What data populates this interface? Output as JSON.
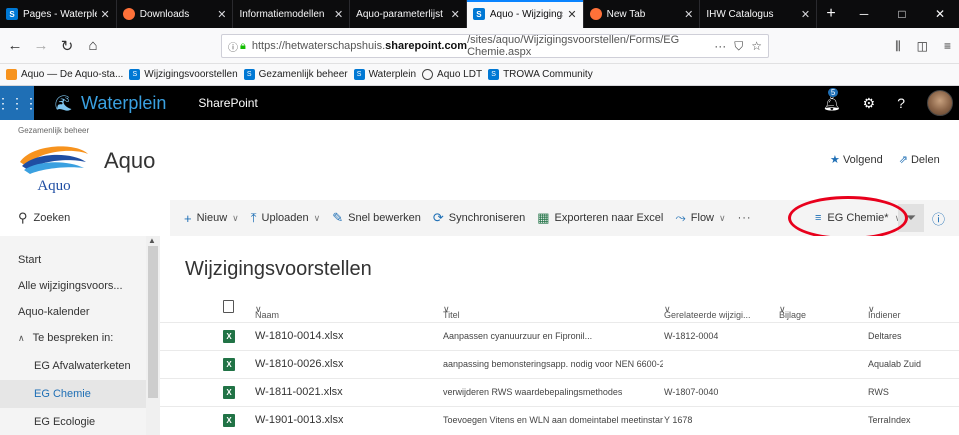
{
  "browser": {
    "tabs": [
      {
        "label": "Pages - Waterplein",
        "icon": "sharepoint-icon",
        "active": false
      },
      {
        "label": "Downloads",
        "icon": "firefox-icon",
        "active": false
      },
      {
        "label": "Informatiemodellen",
        "icon": "",
        "active": false
      },
      {
        "label": "Aquo-parameterlijst",
        "icon": "",
        "active": false
      },
      {
        "label": "Aquo - Wijzigings",
        "icon": "sharepoint-icon",
        "active": true
      },
      {
        "label": "New Tab",
        "icon": "firefox-icon",
        "active": false
      },
      {
        "label": "IHW Catalogus",
        "icon": "",
        "active": false
      }
    ],
    "url_prefix": "https://hetwaterschapshuis.",
    "url_domain": "sharepoint.com",
    "url_path": "/sites/aquo/Wijzigingsvoorstellen/Forms/EG Chemie.aspx",
    "bookmarks": [
      {
        "label": "Aquo — De Aquo-sta...",
        "icon": "aquo-icon"
      },
      {
        "label": "Wijzigingsvoorstellen",
        "icon": "sharepoint-icon"
      },
      {
        "label": "Gezamenlijk beheer",
        "icon": "sharepoint-icon"
      },
      {
        "label": "Waterplein",
        "icon": "sharepoint-icon"
      },
      {
        "label": "Aquo LDT",
        "icon": "globe-icon"
      },
      {
        "label": "TROWA Community",
        "icon": "sharepoint-icon"
      }
    ]
  },
  "suitebar": {
    "brand": "Waterplein",
    "product": "SharePoint",
    "notification_count": "5"
  },
  "site": {
    "group": "Gezamenlijk beheer",
    "title": "Aquo",
    "logo_text": "Aquo",
    "follow_label": "Volgend",
    "share_label": "Delen"
  },
  "commandbar": {
    "search_label": "Zoeken",
    "new_label": "Nieuw",
    "upload_label": "Uploaden",
    "quickedit_label": "Snel bewerken",
    "sync_label": "Synchroniseren",
    "export_label": "Exporteren naar Excel",
    "flow_label": "Flow",
    "more_label": "···",
    "view_label": "EG Chemie*"
  },
  "leftnav": {
    "items": [
      {
        "label": "Start"
      },
      {
        "label": "Alle wijzigingsvoors..."
      },
      {
        "label": "Aquo-kalender"
      },
      {
        "label": "Te bespreken in:"
      },
      {
        "label": "EG Afvalwaterketen"
      },
      {
        "label": "EG Chemie"
      },
      {
        "label": "EG Ecologie"
      }
    ]
  },
  "library": {
    "title": "Wijzigingsvoorstellen",
    "columns": {
      "name": "Naam",
      "title": "Titel",
      "related": "Gerelateerde wijzigi...",
      "attachment": "Bijlage",
      "submitter": "Indiener"
    },
    "rows": [
      {
        "name": "W-1810-0014.xlsx",
        "title": "Aanpassen cyanuurzuur en Fipronil...",
        "related": "W-1812-0004",
        "submitter": "Deltares"
      },
      {
        "name": "W-1810-0026.xlsx",
        "title": "aanpassing bemonsteringsapp. nodig voor NEN 6600-2",
        "related": "",
        "submitter": "Aqualab Zuid"
      },
      {
        "name": "W-1811-0021.xlsx",
        "title": "verwijderen RWS waardebepalingsmethodes",
        "related": "W-1807-0040",
        "submitter": "RWS"
      },
      {
        "name": "W-1901-0013.xlsx",
        "title": "Toevoegen Vitens en WLN aan domeintabel meetinstar",
        "related": "Y 1678",
        "submitter": "TerraIndex"
      }
    ]
  },
  "colors": {
    "accent": "#1f6fb5",
    "highlight": "#e8001c",
    "excel": "#217346"
  }
}
